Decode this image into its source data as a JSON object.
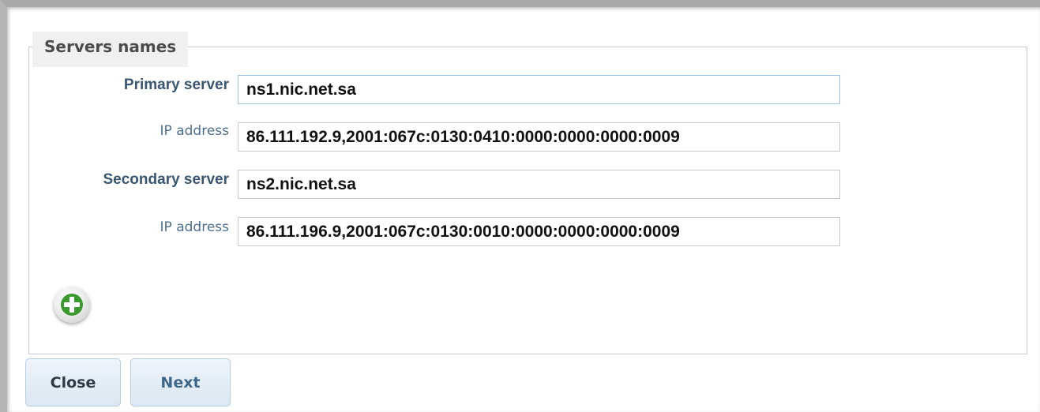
{
  "fieldset": {
    "legend": "Servers names"
  },
  "servers": [
    {
      "label": "Primary server",
      "value": "ns1.nic.net.sa"
    },
    {
      "label": "IP address",
      "value": "86.111.192.9,2001:067c:0130:0410:0000:0000:0000:0009"
    },
    {
      "label": "Secondary server",
      "value": "ns2.nic.net.sa"
    },
    {
      "label": "IP address",
      "value": "86.111.196.9,2001:067c:0130:0010:0000:0000:0000:0009"
    }
  ],
  "actions": {
    "add_icon": "plus-circle-icon",
    "close_label": "Close",
    "next_label": "Next"
  },
  "colors": {
    "accent_green": "#3a9a2e",
    "button_blue": "#dbe7f2"
  }
}
